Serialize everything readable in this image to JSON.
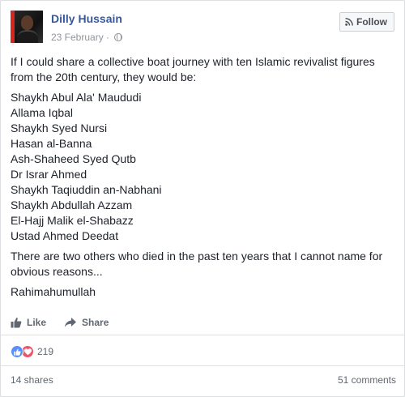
{
  "post": {
    "author": "Dilly Hussain",
    "date": "23 February",
    "date_separator": "·",
    "follow_label": "Follow",
    "intro": "If I could share a collective boat journey with ten Islamic revivalist figures from the 20th century, they would be:",
    "figures": [
      "Shaykh Abul Ala' Maududi",
      "Allama Iqbal",
      "Shaykh Syed Nursi",
      "Hasan al-Banna",
      "Ash-Shaheed Syed Qutb",
      "Dr Israr Ahmed",
      "Shaykh Taqiuddin an-Nabhani",
      "Shaykh Abdullah Azzam",
      "El-Hajj Malik el-Shabazz",
      "Ustad Ahmed Deedat"
    ],
    "outro": "There are two others who died in the past ten years that I cannot name for obvious reasons...",
    "closing": "Rahimahumullah"
  },
  "actions": {
    "like_label": "Like",
    "share_label": "Share"
  },
  "engagement": {
    "reaction_count": "219",
    "reaction_icons": [
      "like-icon",
      "love-icon"
    ],
    "shares": "14 shares",
    "comments": "51 comments"
  },
  "colors": {
    "name_link": "#365899",
    "like_blue": "#5890ff",
    "love_red": "#f25268",
    "muted": "#90949c"
  }
}
